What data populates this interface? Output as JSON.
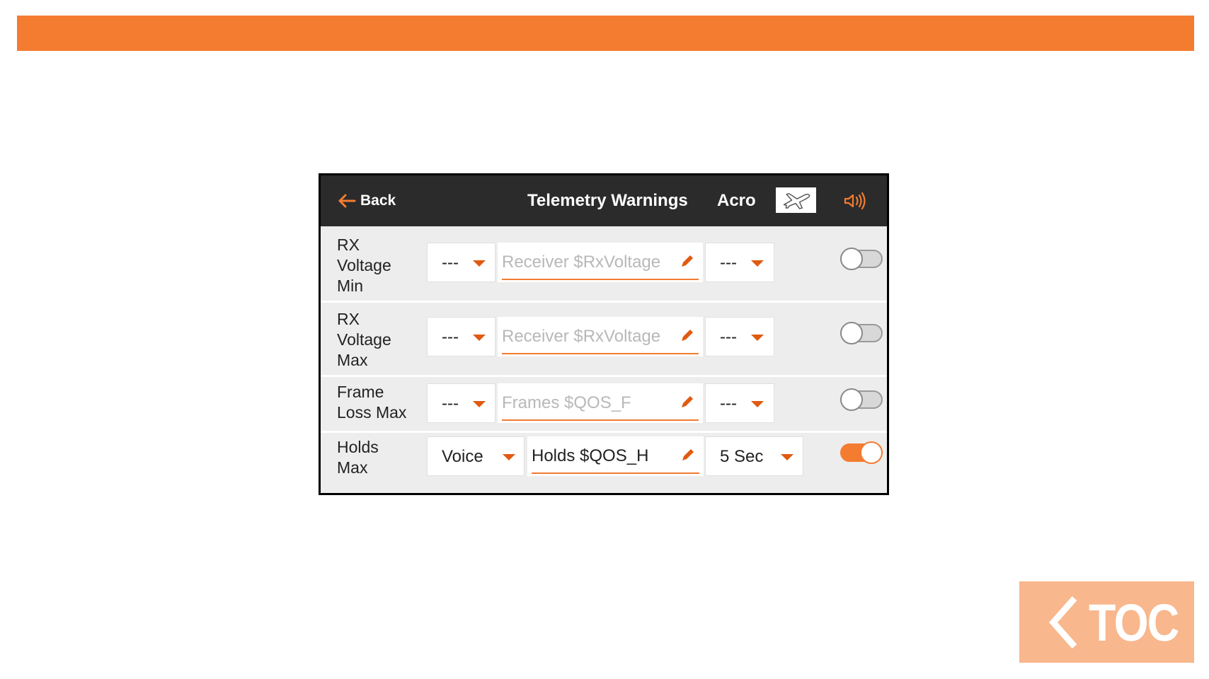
{
  "header": {
    "back_label": "Back",
    "title": "Telemetry Warnings",
    "mode": "Acro",
    "model_icon": "airplane-icon",
    "sound_icon": "speaker-icon"
  },
  "rows": [
    {
      "label_lines": [
        "RX",
        "Voltage",
        "Min"
      ],
      "alert_select": "---",
      "text_value": "Receiver $RxVoltage",
      "text_is_placeholder": true,
      "repeat_select": "---",
      "enabled": false
    },
    {
      "label_lines": [
        "RX",
        "Voltage",
        "Max"
      ],
      "alert_select": "---",
      "text_value": "Receiver $RxVoltage",
      "text_is_placeholder": true,
      "repeat_select": "---",
      "enabled": false
    },
    {
      "label_lines": [
        "Frame",
        "Loss Max"
      ],
      "alert_select": "---",
      "text_value": "Frames $QOS_F",
      "text_is_placeholder": true,
      "repeat_select": "---",
      "enabled": false
    },
    {
      "label_lines": [
        "Holds",
        "Max"
      ],
      "alert_select": "Voice",
      "text_value": "Holds $QOS_H",
      "text_is_placeholder": false,
      "repeat_select": "5 Sec",
      "enabled": true
    }
  ],
  "toc": {
    "label": "TOC"
  },
  "colors": {
    "accent": "#f47c30",
    "header_bg": "#2b2b2b",
    "toc_bg": "#f8b78c"
  }
}
